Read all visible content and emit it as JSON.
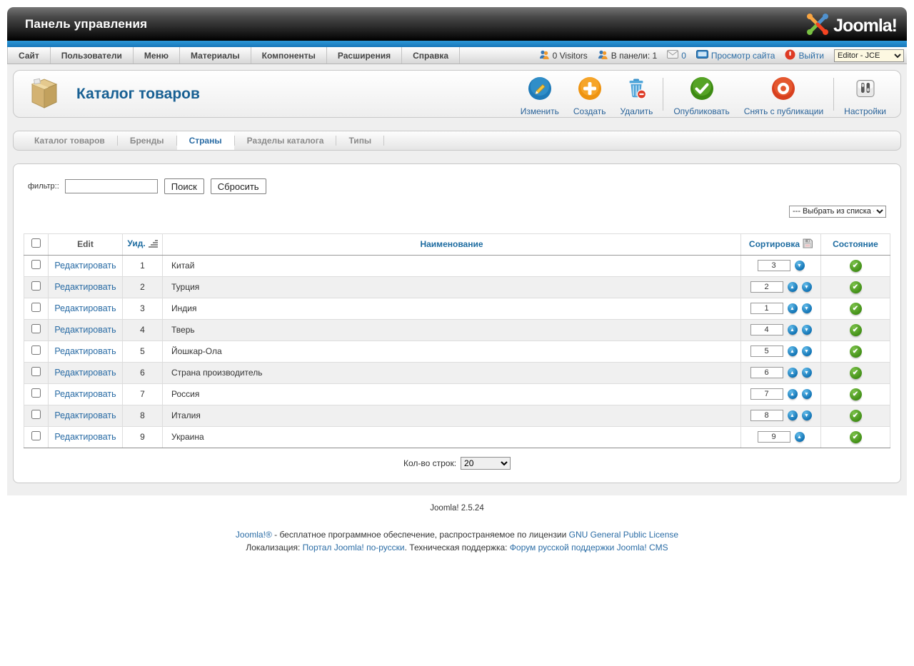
{
  "window": {
    "title": "Панель управления",
    "brand": "Joomla!"
  },
  "menubar": {
    "items": [
      "Сайт",
      "Пользователи",
      "Меню",
      "Материалы",
      "Компоненты",
      "Расширения",
      "Справка"
    ],
    "visitors": "0 Visitors",
    "logged_in": "В панели: 1",
    "messages": "0",
    "preview": "Просмотр сайта",
    "logout": "Выйти",
    "editor": "Editor - JCE"
  },
  "page": {
    "title": "Каталог товаров"
  },
  "toolbar": {
    "buttons": [
      {
        "label": "Изменить",
        "icon": "edit-pencil"
      },
      {
        "label": "Создать",
        "icon": "new-plus"
      },
      {
        "label": "Удалить",
        "icon": "trash"
      },
      {
        "label": "Опубликовать",
        "icon": "publish-check"
      },
      {
        "label": "Снять с публикации",
        "icon": "unpublish-circle"
      },
      {
        "label": "Настройки",
        "icon": "options-panel"
      }
    ]
  },
  "tabs": [
    {
      "label": "Каталог товаров",
      "active": false
    },
    {
      "label": "Бренды",
      "active": false
    },
    {
      "label": "Страны",
      "active": true
    },
    {
      "label": "Разделы каталога",
      "active": false
    },
    {
      "label": "Типы",
      "active": false
    }
  ],
  "filter": {
    "label": "фильтр::",
    "value": "",
    "search": "Поиск",
    "reset": "Сбросить",
    "category_select": "--- Выбрать из списка ---"
  },
  "table": {
    "headers": {
      "edit": "Edit",
      "uid": "Уид.",
      "name": "Наименование",
      "order": "Сортировка",
      "state": "Состояние"
    },
    "edit_label": "Редактировать",
    "rows": [
      {
        "uid": "1",
        "name": "Китай",
        "order": "3",
        "up": false,
        "down": true,
        "published": true
      },
      {
        "uid": "2",
        "name": "Турция",
        "order": "2",
        "up": true,
        "down": true,
        "published": true
      },
      {
        "uid": "3",
        "name": "Индия",
        "order": "1",
        "up": true,
        "down": true,
        "published": true
      },
      {
        "uid": "4",
        "name": "Тверь",
        "order": "4",
        "up": true,
        "down": true,
        "published": true
      },
      {
        "uid": "5",
        "name": "Йошкар-Ола",
        "order": "5",
        "up": true,
        "down": true,
        "published": true
      },
      {
        "uid": "6",
        "name": "Страна производитель",
        "order": "6",
        "up": true,
        "down": true,
        "published": true
      },
      {
        "uid": "7",
        "name": "Россия",
        "order": "7",
        "up": true,
        "down": true,
        "published": true
      },
      {
        "uid": "8",
        "name": "Италия",
        "order": "8",
        "up": true,
        "down": true,
        "published": true
      },
      {
        "uid": "9",
        "name": "Украина",
        "order": "9",
        "up": true,
        "down": false,
        "published": true
      }
    ],
    "pagination": {
      "label": "Кол-во строк:",
      "value": "20"
    }
  },
  "footer": {
    "version": "Joomla! 2.5.24",
    "license": {
      "link1": "Joomla!®",
      "text1": " - бесплатное программное обеспечение, распространяемое по лицензии ",
      "link2": "GNU General Public License"
    },
    "support": {
      "text1": "Локализация: ",
      "link1": "Портал Joomla! по-русски",
      "text2": ". Техническая поддержка: ",
      "link2": "Форум русской поддержки Joomla! CMS"
    }
  },
  "colors": {
    "accent_blue": "#1c82c6",
    "link_blue": "#2a6ca5",
    "published_green": "#44a51c",
    "create_orange": "#f7980a",
    "logout_red": "#e03c2f"
  }
}
